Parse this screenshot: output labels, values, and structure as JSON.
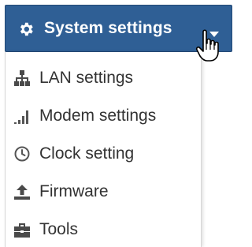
{
  "menu_button": {
    "label": "System settings",
    "icon": "gear-icon",
    "indicator": "caret-down-icon",
    "colors": {
      "background": "#2f5f95",
      "text": "#ffffff"
    }
  },
  "dropdown": {
    "items": [
      {
        "label": "LAN settings",
        "icon": "network-icon"
      },
      {
        "label": "Modem settings",
        "icon": "signal-bars-icon"
      },
      {
        "label": "Clock setting",
        "icon": "clock-icon"
      },
      {
        "label": "Firmware",
        "icon": "upload-icon"
      },
      {
        "label": "Tools",
        "icon": "toolbox-icon"
      }
    ],
    "colors": {
      "text": "#333333",
      "border": "#d6d6d6"
    }
  },
  "cursor": {
    "type": "hand-pointer-icon"
  }
}
